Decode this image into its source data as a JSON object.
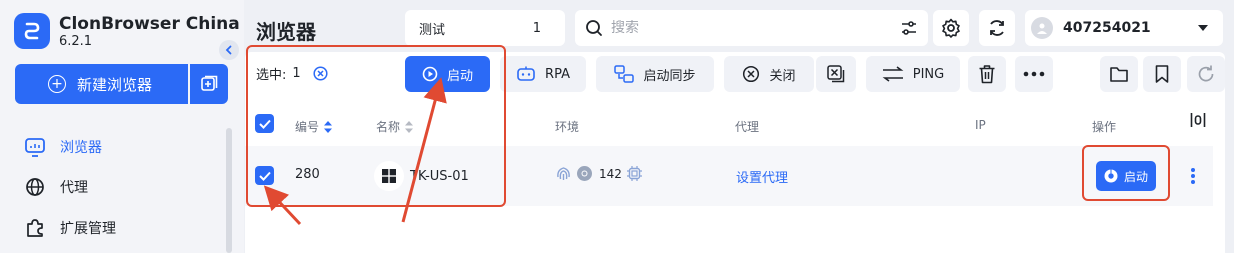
{
  "app": {
    "name": "ClonBrowser China",
    "version": "6.2.1"
  },
  "sidebar": {
    "new_browser_label": "新建浏览器",
    "items": [
      {
        "label": "浏览器",
        "icon": "monitor-icon",
        "active": true
      },
      {
        "label": "代理",
        "icon": "globe-icon"
      },
      {
        "label": "扩展管理",
        "icon": "puzzle-icon"
      }
    ]
  },
  "header": {
    "title": "浏览器",
    "group": {
      "name": "测试",
      "count": "1"
    },
    "search": {
      "placeholder": "搜索",
      "value": ""
    },
    "user": {
      "id": "407254021"
    }
  },
  "toolbar": {
    "selected_label": "选中:",
    "selected_count": "1",
    "start_label": "启动",
    "rpa_label": "RPA",
    "sync_label": "启动同步",
    "close_label": "关闭",
    "ping_label": "PING"
  },
  "table": {
    "columns": {
      "id": "编号",
      "name": "名称",
      "env": "环境",
      "proxy": "代理",
      "ip": "IP",
      "actions": "操作"
    },
    "rows": [
      {
        "id": "280",
        "name": "TK-US-01",
        "os": "windows-icon",
        "env_version": "142",
        "proxy": "设置代理",
        "ip": "",
        "action_label": "启动",
        "checked": true
      }
    ]
  },
  "colors": {
    "accent": "#2b6af6",
    "annotation": "#e04a32"
  }
}
